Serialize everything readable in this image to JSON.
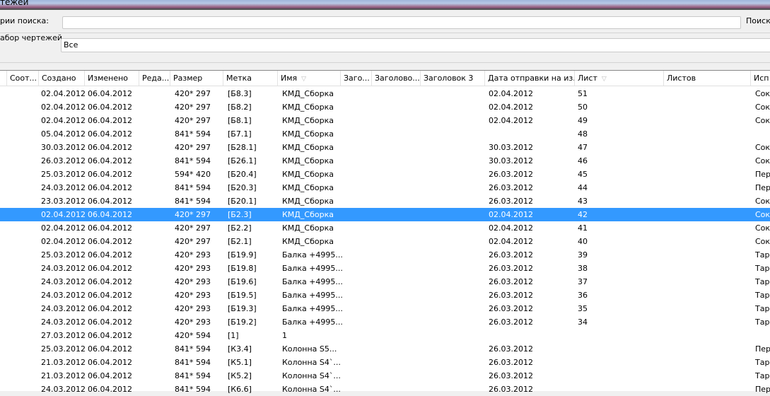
{
  "window": {
    "title": "тежей"
  },
  "search": {
    "label": "рии поиска:",
    "value": "",
    "button": "Поиск"
  },
  "drawing_set": {
    "label": "абор чертежей",
    "value": "Все"
  },
  "columns": [
    "",
    "Соот...",
    "Создано",
    "Изменено",
    "Реда...",
    "Размер",
    "Метка",
    "Имя",
    "Заго...",
    "Заголово...",
    "Заголовок 3",
    "Дата отправки на из...",
    "Лист",
    "Листов",
    "Исп"
  ],
  "rows": [
    [
      "02.04.2012",
      "06.04.2012",
      "420* 297",
      "[Б8.3]",
      "КМД_Сборка",
      "02.04.2012",
      "51",
      "Сок"
    ],
    [
      "02.04.2012",
      "06.04.2012",
      "420* 297",
      "[Б8.2]",
      "КМД_Сборка",
      "02.04.2012",
      "50",
      "Сок"
    ],
    [
      "02.04.2012",
      "06.04.2012",
      "420* 297",
      "[Б8.1]",
      "КМД_Сборка",
      "02.04.2012",
      "49",
      "Сок"
    ],
    [
      "05.04.2012",
      "06.04.2012",
      "841* 594",
      "[Б7.1]",
      "КМД_Сборка",
      "",
      "48",
      ""
    ],
    [
      "30.03.2012",
      "06.04.2012",
      "420* 297",
      "[Б28.1]",
      "КМД_Сборка",
      "30.03.2012",
      "47",
      "Сок"
    ],
    [
      "26.03.2012",
      "06.04.2012",
      "841* 594",
      "[Б26.1]",
      "КМД_Сборка",
      "30.03.2012",
      "46",
      "Сок"
    ],
    [
      "25.03.2012",
      "06.04.2012",
      "594* 420",
      "[Б20.4]",
      "КМД_Сборка",
      "26.03.2012",
      "45",
      "Пер"
    ],
    [
      "24.03.2012",
      "06.04.2012",
      "841* 594",
      "[Б20.3]",
      "КМД_Сборка",
      "26.03.2012",
      "44",
      "Пер"
    ],
    [
      "23.03.2012",
      "06.04.2012",
      "841* 594",
      "[Б20.1]",
      "КМД_Сборка",
      "26.03.2012",
      "43",
      "Сок"
    ],
    [
      "02.04.2012",
      "06.04.2012",
      "420* 297",
      "[Б2.3]",
      "КМД_Сборка",
      "02.04.2012",
      "42",
      "Сок"
    ],
    [
      "02.04.2012",
      "06.04.2012",
      "420* 297",
      "[Б2.2]",
      "КМД_Сборка",
      "02.04.2012",
      "41",
      "Сок"
    ],
    [
      "02.04.2012",
      "06.04.2012",
      "420* 297",
      "[Б2.1]",
      "КМД_Сборка",
      "02.04.2012",
      "40",
      "Сок"
    ],
    [
      "25.03.2012",
      "06.04.2012",
      "420* 293",
      "[Б19.9]",
      "Балка +4995...",
      "26.03.2012",
      "39",
      "Тар"
    ],
    [
      "24.03.2012",
      "06.04.2012",
      "420* 293",
      "[Б19.8]",
      "Балка +4995...",
      "26.03.2012",
      "38",
      "Тар"
    ],
    [
      "24.03.2012",
      "06.04.2012",
      "420* 293",
      "[Б19.6]",
      "Балка +4995...",
      "26.03.2012",
      "37",
      "Тар"
    ],
    [
      "24.03.2012",
      "06.04.2012",
      "420* 293",
      "[Б19.5]",
      "Балка +4995...",
      "26.03.2012",
      "36",
      "Тар"
    ],
    [
      "24.03.2012",
      "06.04.2012",
      "420* 293",
      "[Б19.3]",
      "Балка +4995...",
      "26.03.2012",
      "35",
      "Тар"
    ],
    [
      "24.03.2012",
      "06.04.2012",
      "420* 293",
      "[Б19.2]",
      "Балка +4995...",
      "26.03.2012",
      "34",
      "Тар"
    ],
    [
      "27.03.2012",
      "06.04.2012",
      "420* 594",
      "[1]",
      "1",
      "",
      "",
      ""
    ],
    [
      "25.03.2012",
      "06.04.2012",
      "841* 594",
      "[К3.4]",
      " Колонна S5...",
      "26.03.2012",
      "",
      "Пер"
    ],
    [
      "21.03.2012",
      "06.04.2012",
      "841* 594",
      "[К5.1]",
      " Колонна S4`...",
      "26.03.2012",
      "",
      "Тар"
    ],
    [
      "21.03.2012",
      "06.04.2012",
      "841* 594",
      "[К5.2]",
      " Колонна S4`...",
      "26.03.2012",
      "",
      "Тар"
    ],
    [
      "24.03.2012",
      "06.04.2012",
      "841* 594",
      "[К6.6]",
      " Колонна S4`...",
      "26.03.2012",
      "",
      "Пер"
    ]
  ],
  "selected_row": 9
}
